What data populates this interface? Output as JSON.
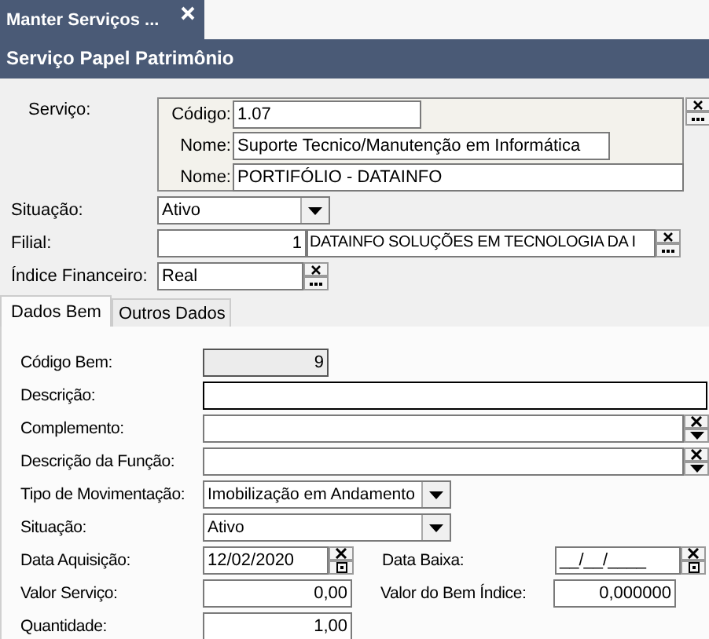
{
  "doc_tab": {
    "label": "Manter Serviços ..."
  },
  "header": "Serviço Papel Patrimônio",
  "servico": {
    "label": "Serviço:",
    "codigo_label": "Código:",
    "codigo": "1.07",
    "nome_label": "Nome:",
    "nome": "Suporte Tecnico/Manutenção em Informática",
    "nome2_label": "Nome:",
    "nome2": "PORTIFÓLIO - DATAINFO"
  },
  "situacao": {
    "label": "Situação:",
    "value": "Ativo"
  },
  "filial": {
    "label": "Filial:",
    "code": "1",
    "name": "DATAINFO SOLUÇÕES EM TECNOLOGIA DA I"
  },
  "indice": {
    "label": "Índice Financeiro:",
    "value": "Real"
  },
  "tabs": [
    {
      "label": "Dados Bem",
      "selected": true
    },
    {
      "label": "Outros Dados",
      "selected": false
    }
  ],
  "rows": [
    {
      "items": [
        {
          "kind": "readonly",
          "label": "Código Bem:",
          "value": "9"
        }
      ]
    },
    {
      "items": [
        {
          "kind": "text",
          "label": "Descrição:"
        }
      ]
    },
    {
      "items": [
        {
          "kind": "clearable",
          "label": "Complemento:"
        }
      ]
    },
    {
      "items": [
        {
          "kind": "clearable",
          "label": "Descrição da Função:"
        }
      ]
    },
    {
      "items": [
        {
          "kind": "select",
          "label": "Tipo de Movimentação:",
          "value": "Imobilização em Andamento"
        }
      ]
    },
    {
      "items": [
        {
          "kind": "select",
          "label": "Situação:",
          "value": "Ativo"
        }
      ]
    },
    {
      "items": [
        {
          "kind": "date",
          "label": "Data Aquisição:",
          "value": "12/02/2020"
        },
        {
          "kind": "date",
          "label": "Data Baixa:",
          "value": "__/__/____"
        }
      ]
    },
    {
      "items": [
        {
          "kind": "number",
          "label": "Valor Serviço:",
          "value": "0,00"
        },
        {
          "kind": "number",
          "label": "Valor do Bem Índice:",
          "value": "0,000000"
        }
      ]
    },
    {
      "items": [
        {
          "kind": "number",
          "label": "Quantidade:",
          "value": "1,00"
        }
      ]
    }
  ]
}
